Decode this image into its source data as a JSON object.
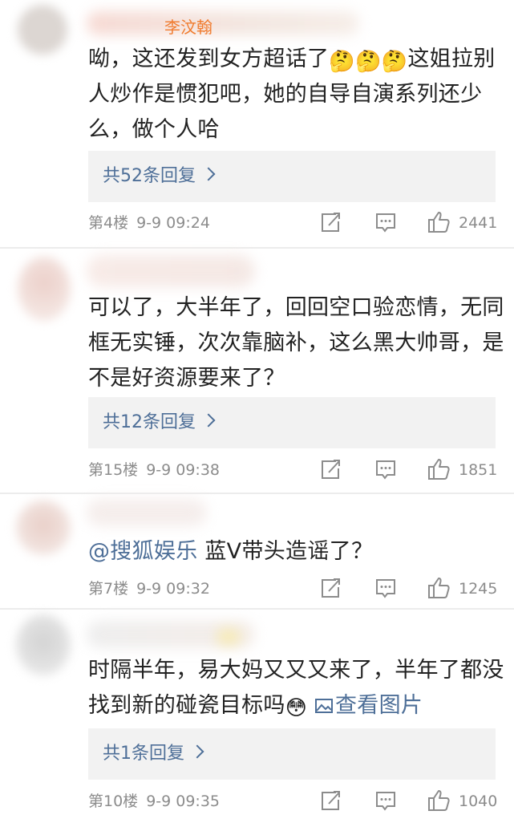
{
  "comments": [
    {
      "username": "李汶翰",
      "text_lines": [
        "呦，这还发到女方超话了",
        "这姐拉别",
        "人炒作是惯犯吧，她的自导自演系列还少",
        "么，做个人哈"
      ],
      "emoji": "🤔🤔🤔",
      "reply_label": "共52条回复",
      "floor": "第4楼",
      "time": "9-9 09:24",
      "likes": "2441"
    },
    {
      "text_lines": [
        "可以了，大半年了，回回空口验恋情，无同",
        "框无实锤，次次靠脑补，这么黑大帅哥，是",
        "不是好资源要来了？"
      ],
      "reply_label": "共12条回复",
      "floor": "第15楼",
      "time": "9-9 09:38",
      "likes": "1851"
    },
    {
      "mention": "@搜狐娱乐",
      "text_lines": [
        " 蓝V带头造谣了？"
      ],
      "floor": "第7楼",
      "time": "9-9 09:32",
      "likes": "1245"
    },
    {
      "text_lines": [
        "时隔半年，易大妈又又又来了，半年了都没",
        "找到新的碰瓷目标吗"
      ],
      "emoji": "😳",
      "image_link": "查看图片",
      "reply_label": "共1条回复",
      "floor": "第10楼",
      "time": "9-9 09:35",
      "likes": "1040"
    }
  ],
  "colors": {
    "accent_orange": "#f07b2e",
    "link_blue": "#4e6f98",
    "meta_gray": "#8c8c8c",
    "reply_bg": "#f2f2f2"
  },
  "icons": {
    "forward": "share-out-icon",
    "comment": "comment-bubble-icon",
    "like": "thumbs-up-icon"
  }
}
